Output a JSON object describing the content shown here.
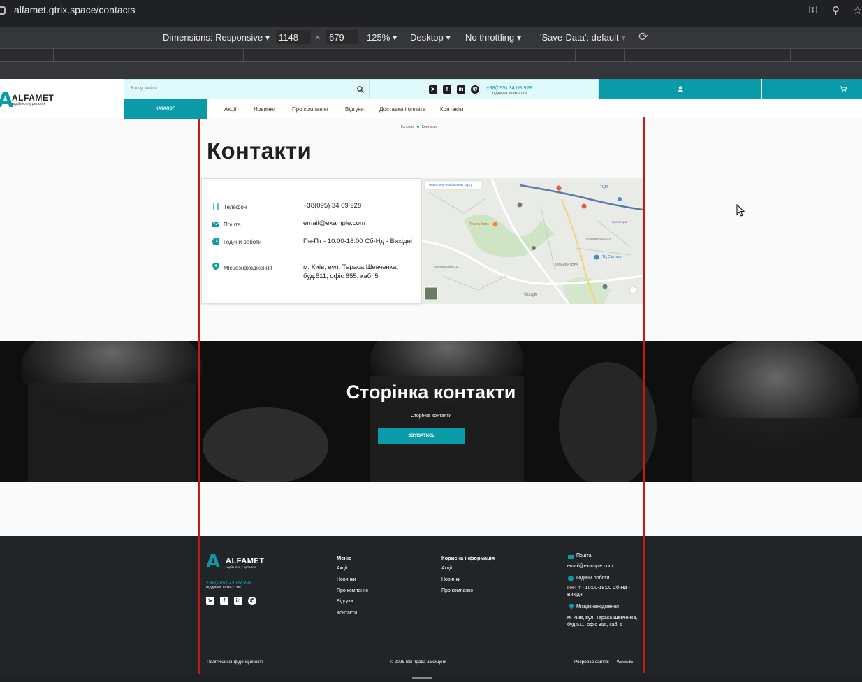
{
  "browser": {
    "url": "alfamet.gtrix.space/contacts",
    "icons": [
      "key-icon",
      "zoom-icon",
      "star-icon"
    ]
  },
  "devtools": {
    "dimensions_label": "Dimensions: Responsive",
    "width_value": "1148",
    "times": "×",
    "height_value": "679",
    "zoom": "125%",
    "device": "Desktop",
    "throttling": "No throttling",
    "save_data": "'Save-Data': default"
  },
  "header": {
    "logo_letter": "A",
    "logo_name": "ALFAMET",
    "logo_tagline": "надійність у деталях",
    "search_placeholder": "Я хочу знайти...",
    "phone": "+38(095) 34 09 928",
    "hours": "Щоденно 10:00-21:00",
    "catalog_label": "КАТАЛОГ",
    "nav": [
      "Акції",
      "Новинки",
      "Про компанію",
      "Відгуки",
      "Доставка і оплата",
      "Контакти"
    ]
  },
  "breadcrumb": {
    "home": "Головна",
    "current": "Контакти"
  },
  "page_title": "Контакти",
  "contacts": [
    {
      "icon": "phone-icon",
      "label": "Телефон",
      "value": "+38(095) 34 09 928"
    },
    {
      "icon": "mail-icon",
      "label": "Пошта",
      "value": "email@example.com"
    },
    {
      "icon": "clock-icon",
      "label": "Години роботи",
      "value": "Пн-Пт - 10:00-18:00 Сб-Нд - Вихідні"
    },
    {
      "icon": "location-pin-icon",
      "label": "Місцезнаходження",
      "value": "м. Київ, вул. Тараса Шевченка, буд.511, офіс 855, каб. 5"
    }
  ],
  "map": {
    "open_map_label": "Переглянути збільшену карту",
    "places": [
      "ТЦМ",
      "Пузата Хата",
      "Чорна гора",
      "ТЦ Світлиця",
      "БАТИЄВА ГОРА",
      "ЧЕРВОНІЙ ВІНА",
      "СОЛОМ'ЯНСЬКА",
      "Google"
    ]
  },
  "banner": {
    "title": "Сторінка контакти",
    "subtitle": "Сторінка контакти",
    "button": "ЗВ'ЯЗАТИСЬ"
  },
  "footer": {
    "logo_name": "ALFAMET",
    "logo_tagline": "надійність у деталях",
    "phone": "+38(095) 34 09 928",
    "hours": "Щоденно 10:00-21:00",
    "menu_title": "Меню",
    "menu": [
      "Акції",
      "Новинки",
      "Про компанію",
      "Відгуки",
      "Контакти"
    ],
    "info_title": "Корисна інформація",
    "info": [
      "Акції",
      "Новинки",
      "Про компанію"
    ],
    "mail_label": "Пошта",
    "mail_value": "email@example.com",
    "hours_label": "Години роботи",
    "hours_value": "Пн-Пт - 10:00-18:00 Сб-Нд - Вихідні",
    "location_label": "Місцезнаходження",
    "location_value": "м. Київ, вул. Тараса Шевченка, буд.511, офіс 855, каб. 5",
    "privacy": "Політика конфіденційності",
    "copyright": "© 2025 Всі права захищені",
    "developer_label": "Розробка сайтів:",
    "developer_name": "Wekstudio"
  },
  "colors": {
    "accent": "#0a9ba8",
    "footer_bg": "#222528",
    "guide_line": "#c51a1a"
  }
}
